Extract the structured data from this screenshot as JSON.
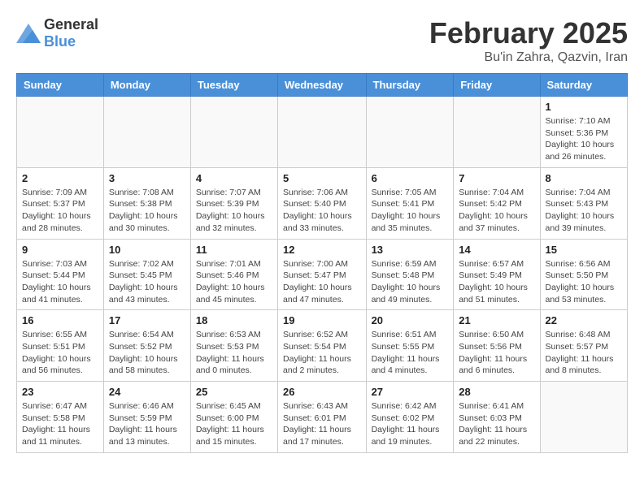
{
  "logo": {
    "general": "General",
    "blue": "Blue"
  },
  "header": {
    "month": "February 2025",
    "location": "Bu'in Zahra, Qazvin, Iran"
  },
  "days_of_week": [
    "Sunday",
    "Monday",
    "Tuesday",
    "Wednesday",
    "Thursday",
    "Friday",
    "Saturday"
  ],
  "weeks": [
    [
      {
        "day": "",
        "info": ""
      },
      {
        "day": "",
        "info": ""
      },
      {
        "day": "",
        "info": ""
      },
      {
        "day": "",
        "info": ""
      },
      {
        "day": "",
        "info": ""
      },
      {
        "day": "",
        "info": ""
      },
      {
        "day": "1",
        "info": "Sunrise: 7:10 AM\nSunset: 5:36 PM\nDaylight: 10 hours and 26 minutes."
      }
    ],
    [
      {
        "day": "2",
        "info": "Sunrise: 7:09 AM\nSunset: 5:37 PM\nDaylight: 10 hours and 28 minutes."
      },
      {
        "day": "3",
        "info": "Sunrise: 7:08 AM\nSunset: 5:38 PM\nDaylight: 10 hours and 30 minutes."
      },
      {
        "day": "4",
        "info": "Sunrise: 7:07 AM\nSunset: 5:39 PM\nDaylight: 10 hours and 32 minutes."
      },
      {
        "day": "5",
        "info": "Sunrise: 7:06 AM\nSunset: 5:40 PM\nDaylight: 10 hours and 33 minutes."
      },
      {
        "day": "6",
        "info": "Sunrise: 7:05 AM\nSunset: 5:41 PM\nDaylight: 10 hours and 35 minutes."
      },
      {
        "day": "7",
        "info": "Sunrise: 7:04 AM\nSunset: 5:42 PM\nDaylight: 10 hours and 37 minutes."
      },
      {
        "day": "8",
        "info": "Sunrise: 7:04 AM\nSunset: 5:43 PM\nDaylight: 10 hours and 39 minutes."
      }
    ],
    [
      {
        "day": "9",
        "info": "Sunrise: 7:03 AM\nSunset: 5:44 PM\nDaylight: 10 hours and 41 minutes."
      },
      {
        "day": "10",
        "info": "Sunrise: 7:02 AM\nSunset: 5:45 PM\nDaylight: 10 hours and 43 minutes."
      },
      {
        "day": "11",
        "info": "Sunrise: 7:01 AM\nSunset: 5:46 PM\nDaylight: 10 hours and 45 minutes."
      },
      {
        "day": "12",
        "info": "Sunrise: 7:00 AM\nSunset: 5:47 PM\nDaylight: 10 hours and 47 minutes."
      },
      {
        "day": "13",
        "info": "Sunrise: 6:59 AM\nSunset: 5:48 PM\nDaylight: 10 hours and 49 minutes."
      },
      {
        "day": "14",
        "info": "Sunrise: 6:57 AM\nSunset: 5:49 PM\nDaylight: 10 hours and 51 minutes."
      },
      {
        "day": "15",
        "info": "Sunrise: 6:56 AM\nSunset: 5:50 PM\nDaylight: 10 hours and 53 minutes."
      }
    ],
    [
      {
        "day": "16",
        "info": "Sunrise: 6:55 AM\nSunset: 5:51 PM\nDaylight: 10 hours and 56 minutes."
      },
      {
        "day": "17",
        "info": "Sunrise: 6:54 AM\nSunset: 5:52 PM\nDaylight: 10 hours and 58 minutes."
      },
      {
        "day": "18",
        "info": "Sunrise: 6:53 AM\nSunset: 5:53 PM\nDaylight: 11 hours and 0 minutes."
      },
      {
        "day": "19",
        "info": "Sunrise: 6:52 AM\nSunset: 5:54 PM\nDaylight: 11 hours and 2 minutes."
      },
      {
        "day": "20",
        "info": "Sunrise: 6:51 AM\nSunset: 5:55 PM\nDaylight: 11 hours and 4 minutes."
      },
      {
        "day": "21",
        "info": "Sunrise: 6:50 AM\nSunset: 5:56 PM\nDaylight: 11 hours and 6 minutes."
      },
      {
        "day": "22",
        "info": "Sunrise: 6:48 AM\nSunset: 5:57 PM\nDaylight: 11 hours and 8 minutes."
      }
    ],
    [
      {
        "day": "23",
        "info": "Sunrise: 6:47 AM\nSunset: 5:58 PM\nDaylight: 11 hours and 11 minutes."
      },
      {
        "day": "24",
        "info": "Sunrise: 6:46 AM\nSunset: 5:59 PM\nDaylight: 11 hours and 13 minutes."
      },
      {
        "day": "25",
        "info": "Sunrise: 6:45 AM\nSunset: 6:00 PM\nDaylight: 11 hours and 15 minutes."
      },
      {
        "day": "26",
        "info": "Sunrise: 6:43 AM\nSunset: 6:01 PM\nDaylight: 11 hours and 17 minutes."
      },
      {
        "day": "27",
        "info": "Sunrise: 6:42 AM\nSunset: 6:02 PM\nDaylight: 11 hours and 19 minutes."
      },
      {
        "day": "28",
        "info": "Sunrise: 6:41 AM\nSunset: 6:03 PM\nDaylight: 11 hours and 22 minutes."
      },
      {
        "day": "",
        "info": ""
      }
    ]
  ]
}
